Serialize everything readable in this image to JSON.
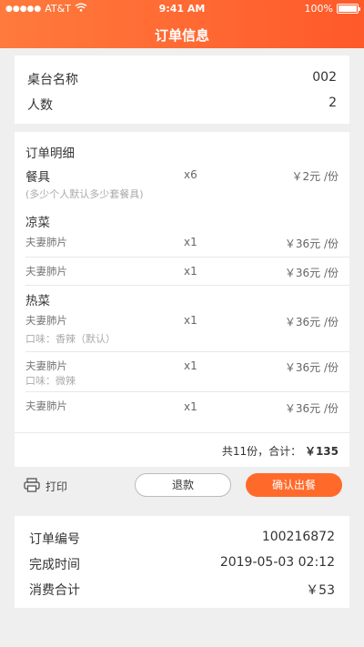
{
  "status_bar": {
    "signal_dots": "●●●●●",
    "carrier": "AT&T",
    "time": "9:41 AM",
    "battery_pct": "100%"
  },
  "header": {
    "title": "订单信息"
  },
  "table_info": {
    "rows": [
      {
        "label": "桌台名称",
        "value": "002"
      },
      {
        "label": "人数",
        "value": "2"
      }
    ]
  },
  "order_detail": {
    "title": "订单明细",
    "tableware": {
      "name": "餐具",
      "qty": "x6",
      "price": "￥2元 /份",
      "note": "(多少个人默认多少套餐具)"
    },
    "cold": {
      "name": "凉菜",
      "items": [
        {
          "name": "夫妻肺片",
          "qty": "x1",
          "price": "￥36元 /份"
        },
        {
          "name": "夫妻肺片",
          "qty": "x1",
          "price": "￥36元 /份"
        }
      ]
    },
    "hot": {
      "name": "热菜",
      "items": [
        {
          "name": "夫妻肺片",
          "qty": "x1",
          "price": "￥36元 /份",
          "note": "口味：香辣（默认）"
        },
        {
          "name": "夫妻肺片",
          "qty": "x1",
          "price": "￥36元 /份",
          "note": "口味：微辣"
        },
        {
          "name": "夫妻肺片",
          "qty": "x1",
          "price": "￥36元 /份"
        }
      ]
    },
    "total_prefix": "共11份，合计：",
    "total_amount": "￥135"
  },
  "actions": {
    "print": "打印",
    "refund": "退款",
    "confirm": "确认出餐"
  },
  "order_summary": {
    "rows": [
      {
        "label": "订单编号",
        "value": "100216872"
      },
      {
        "label": "完成时间",
        "value": "2019-05-03 02:12"
      },
      {
        "label": "消费合计",
        "value": "￥53"
      }
    ]
  }
}
